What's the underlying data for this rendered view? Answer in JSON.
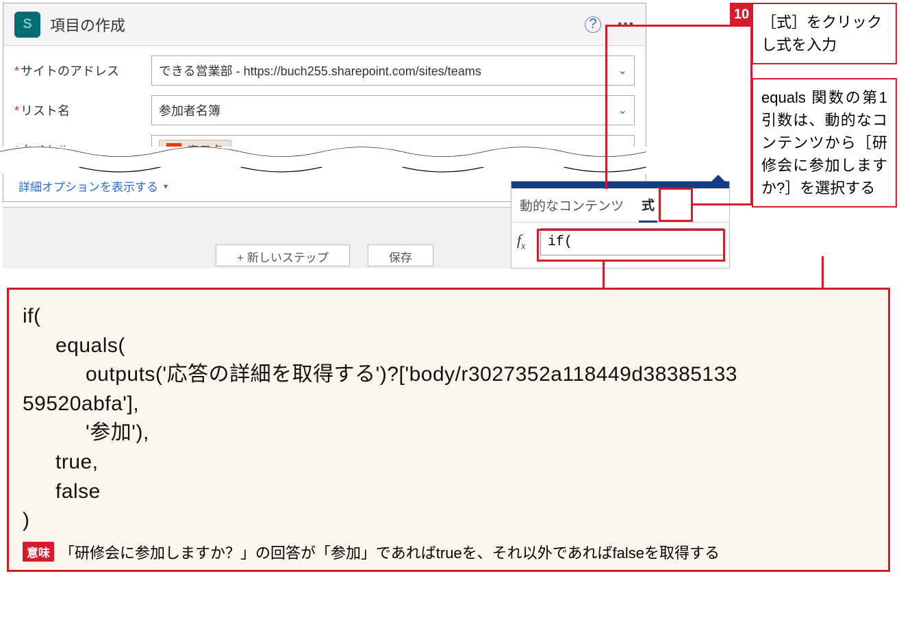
{
  "card": {
    "title": "項目の作成",
    "brand_letter": "S",
    "fields": {
      "site_address": {
        "label": "サイトのアドレス",
        "value": "できる営業部 - https://buch255.sharepoint.com/sites/teams"
      },
      "list_name": {
        "label": "リスト名",
        "value": "参加者名簿"
      },
      "title": {
        "label": "タイトル",
        "pill_text": "表示名",
        "pill_icon": "O"
      }
    },
    "advanced": "詳細オプションを表示する"
  },
  "footer": {
    "new_step": "+ 新しいステップ",
    "save": "保存"
  },
  "expr_panel": {
    "tab_dynamic": "動的なコンテンツ",
    "tab_expr": "式",
    "fx_label": "fx",
    "input_value": "if("
  },
  "callouts": {
    "step_num": "10",
    "step_text": "［式］をクリックし式を入力",
    "desc_text": "equals 関数の第1引数は、動的なコンテンツから［研修会に参加しますか?］を選択する"
  },
  "code": {
    "l1": "if(",
    "l2": "equals(",
    "l3": "outputs('応答の詳細を取得する')?['body/r3027352a118449d38385133",
    "l4": "59520abfa'],",
    "l5": "'参加'),",
    "l6": "true,",
    "l7": "false",
    "l8": ")",
    "meaning_label": "意味",
    "meaning_text": "「研修会に参加しますか？」の回答が「参加」であればtrueを、それ以外であればfalseを取得する"
  }
}
